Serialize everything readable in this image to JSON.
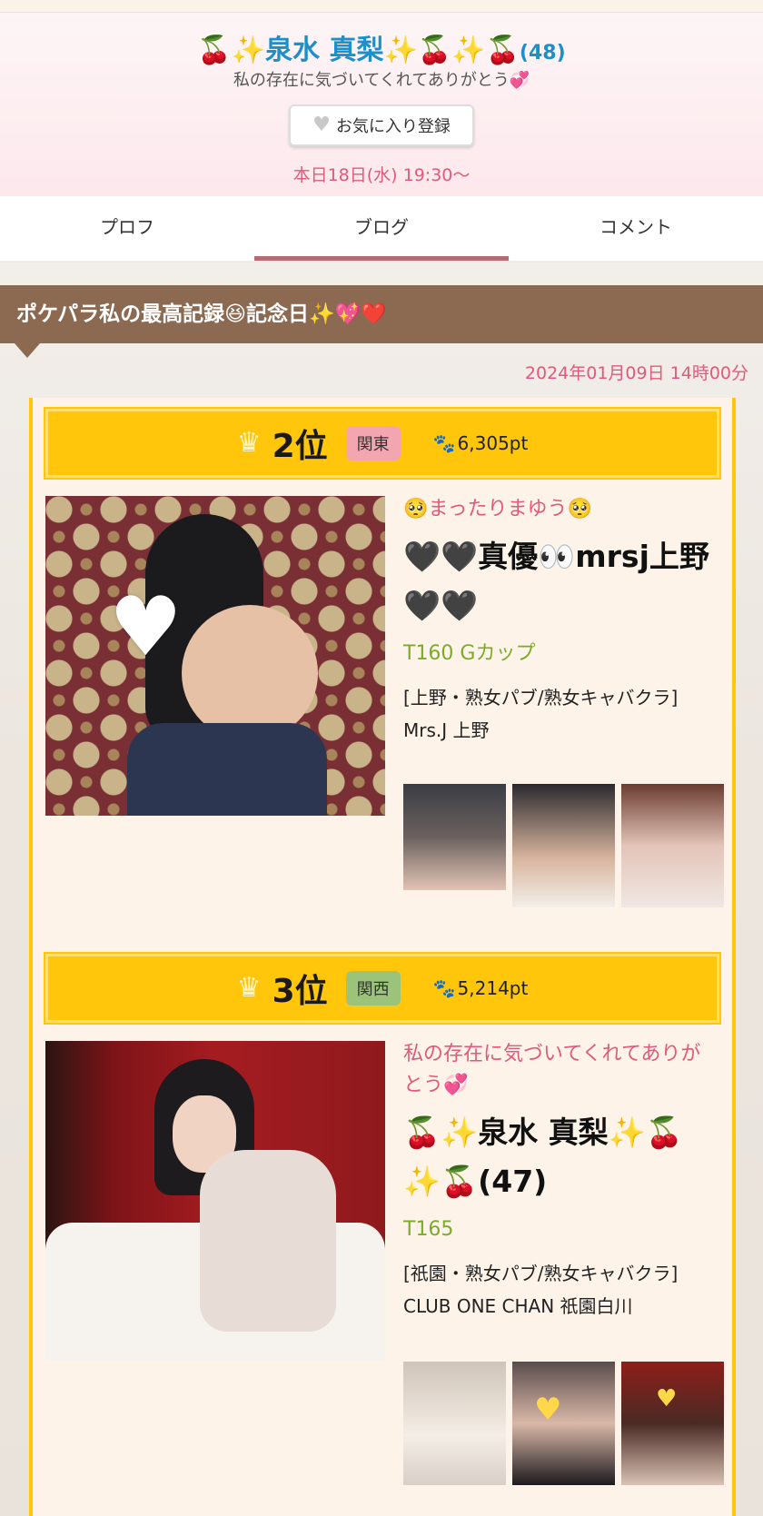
{
  "header": {
    "name": "🍒✨泉水 真梨✨🍒✨🍒",
    "age": "(48)",
    "tagline": "私の存在に気づいてくれてありがとう💞",
    "favorite_label": "お気に入り登録",
    "schedule": "本日18日(水) 19:30〜"
  },
  "tabs": [
    {
      "label": "プロフ"
    },
    {
      "label": "ブログ"
    },
    {
      "label": "コメント"
    }
  ],
  "blog": {
    "title": "ポケパラ私の最高記録😆記念日✨💖❤️",
    "date": "2024年01月09日 14時00分"
  },
  "rankings": [
    {
      "rank": "2位",
      "region": "関東",
      "region_color": "#f4a6b0",
      "points": "6,305pt",
      "catch": "🥺まったりまゆう🥺",
      "name": "🖤🖤真優👀mrsj上野🖤🖤",
      "spec": "T160 Gカップ",
      "shop_category": "[上野・熟女パブ/熟女キャバクラ]",
      "shop_name": "Mrs.J 上野"
    },
    {
      "rank": "3位",
      "region": "関西",
      "region_color": "#9bc47a",
      "points": "5,214pt",
      "catch": "私の存在に気づいてくれてありがとう💞",
      "name": "🍒✨泉水 真梨✨🍒✨🍒(47)",
      "spec": "T165",
      "shop_category": "[祇園・熟女パブ/熟女キャバクラ]",
      "shop_name": "CLUB ONE CHAN 祇園白川"
    }
  ],
  "icons": {
    "crown": "crown-icon",
    "paw": "paw-icon",
    "heart": "heart-icon"
  },
  "colors": {
    "name_blue": "#1e8fc8",
    "accent_pink": "#e05a7a",
    "rank_yellow": "#ffc60b",
    "title_brown": "#8c6a52",
    "spec_green": "#7cab2c"
  }
}
